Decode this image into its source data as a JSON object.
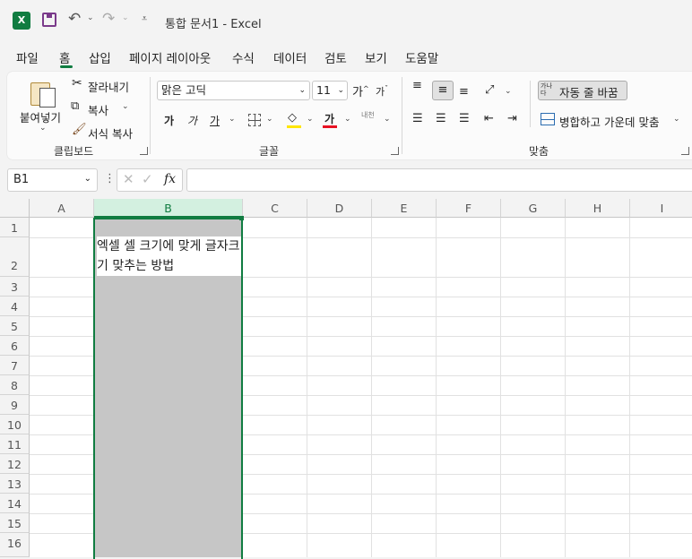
{
  "window": {
    "title": "통합 문서1  -  Excel",
    "app_icon": "X"
  },
  "quick_access": {
    "save": "save-icon",
    "undo": "undo-icon",
    "redo": "redo-icon",
    "customize": "customize-icon"
  },
  "tabs": [
    "파일",
    "홈",
    "삽입",
    "페이지 레이아웃",
    "수식",
    "데이터",
    "검토",
    "보기",
    "도움말"
  ],
  "ribbon": {
    "clipboard": {
      "paste": "붙여넣기",
      "cut": "잘라내기",
      "copy": "복사",
      "format_painter": "서식 복사",
      "label": "클립보드"
    },
    "font": {
      "name": "맑은 고딕",
      "size": "11",
      "grow": "가",
      "shrink": "가",
      "bold": "가",
      "italic": "가",
      "underline": "가",
      "font_color": "가",
      "phonetic": "내천",
      "label": "글꼴",
      "highlight_color": "#ffe600",
      "text_color": "#e81123"
    },
    "alignment": {
      "wrap_icon_text": "가나다",
      "wrap_text": "자동 줄 바꿈",
      "merge_center": "병합하고 가운데 맞춤",
      "label": "맞춤"
    }
  },
  "formula_bar": {
    "name_box": "B1",
    "fx": "fx",
    "value": ""
  },
  "columns": [
    "A",
    "B",
    "C",
    "D",
    "E",
    "F",
    "G",
    "H",
    "I"
  ],
  "rows": [
    "1",
    "2",
    "3",
    "4",
    "5",
    "6",
    "7",
    "8",
    "9",
    "10",
    "11",
    "12",
    "13",
    "14",
    "15",
    "16"
  ],
  "cells": {
    "B2": "엑셀 셀 크기에 맞게 글자크기 맞추는 방법"
  },
  "colors": {
    "accent": "#107c41",
    "selection": "#c6c6c6",
    "header_selected": "#d3f0e0"
  }
}
